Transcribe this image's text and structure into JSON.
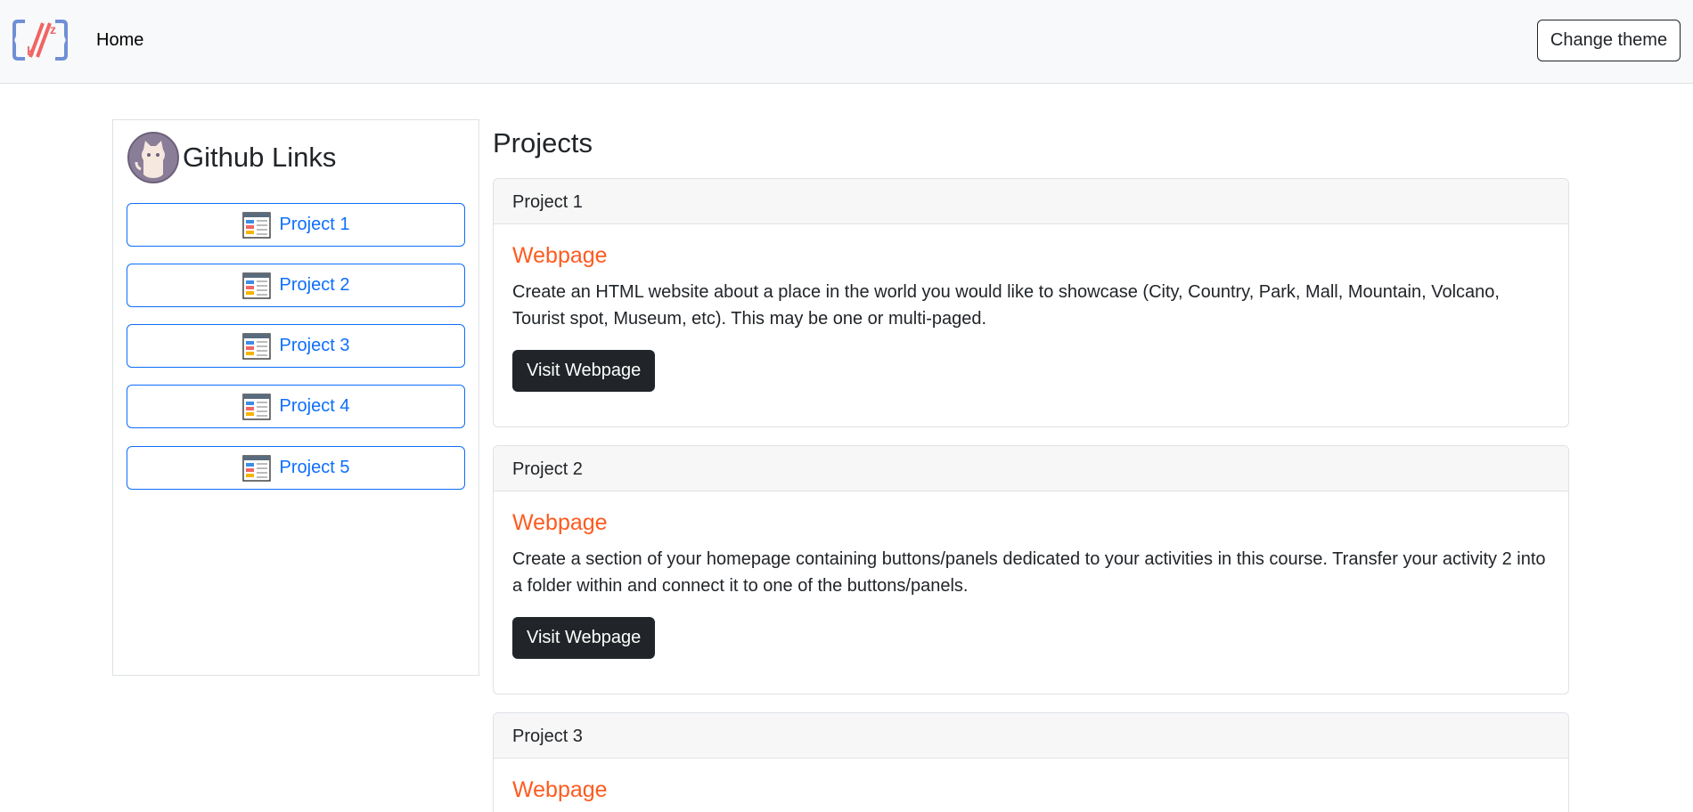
{
  "nav": {
    "home_label": "Home",
    "theme_button_label": "Change theme"
  },
  "sidebar": {
    "title": "Github Links",
    "links": [
      {
        "label": "Project 1"
      },
      {
        "label": "Project 2"
      },
      {
        "label": "Project 3"
      },
      {
        "label": "Project 4"
      },
      {
        "label": "Project 5"
      }
    ]
  },
  "main": {
    "title": "Projects",
    "cards": [
      {
        "header": "Project 1",
        "title": "Webpage",
        "text": "Create an HTML website about a place in the world you would like to showcase (City, Country, Park, Mall, Mountain, Volcano, Tourist spot, Museum, etc). This may be one or multi-paged.",
        "button_label": "Visit Webpage"
      },
      {
        "header": "Project 2",
        "title": "Webpage",
        "text": "Create a section of your homepage containing buttons/panels dedicated to your activities in this course. Transfer your activity 2 into a folder within and connect it to one of the buttons/panels.",
        "button_label": "Visit Webpage"
      },
      {
        "header": "Project 3",
        "title": "Webpage"
      }
    ]
  },
  "colors": {
    "accent_blue": "#0d6efd",
    "title_orange": "#fd5b20",
    "dark_button": "#212529",
    "navbar_bg": "#f8f9fa"
  },
  "icons": {
    "brand": "kz-logo-icon",
    "sidebar_avatar": "github-octocat-icon",
    "link": "webpage-window-icon"
  }
}
